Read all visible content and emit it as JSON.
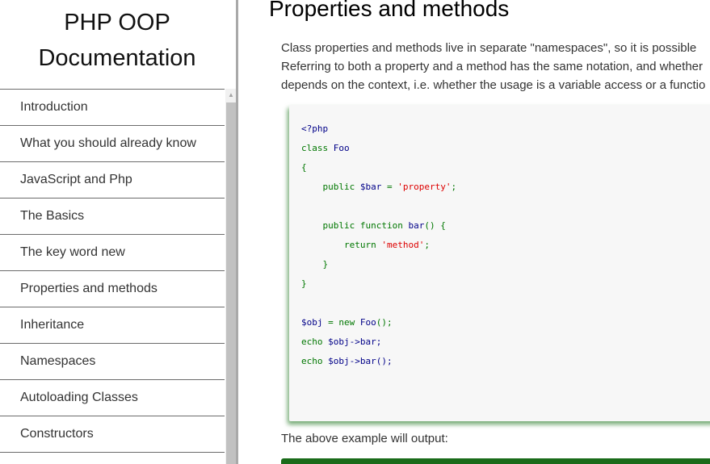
{
  "sidebar": {
    "title_line1": "PHP OOP",
    "title_line2": "Documentation",
    "items": [
      {
        "label": "Introduction"
      },
      {
        "label": "What you should already know"
      },
      {
        "label": "JavaScript and Php"
      },
      {
        "label": "The Basics"
      },
      {
        "label": "The key word new"
      },
      {
        "label": "Properties and methods"
      },
      {
        "label": "Inheritance"
      },
      {
        "label": "Namespaces"
      },
      {
        "label": "Autoloading Classes"
      },
      {
        "label": "Constructors"
      }
    ],
    "scroll_up_icon": "triangle-up-icon"
  },
  "main": {
    "title": "Properties and methods",
    "intro": [
      "Class properties and methods live in separate \"namespaces\", so it is possible",
      "Referring to both a property and a method has the same notation, and whether",
      "depends on the context, i.e. whether the usage is a variable access or a functio"
    ],
    "code": {
      "open_tag": "<?php",
      "class_kw": "class",
      "class_name": "Foo",
      "brace_open": "{",
      "public1": "public",
      "prop_var": "$bar",
      "assign": "=",
      "prop_val": "'property'",
      "semicolon": ";",
      "public2": "public",
      "function_kw": "function",
      "method_name": "bar",
      "method_sig_rest": "() {",
      "return_kw": "return",
      "return_val": "'method'",
      "inner_close": "}",
      "brace_close": "}",
      "obj_var": "$obj",
      "new_kw": "new",
      "new_class": "Foo",
      "new_rest": "();",
      "echo1": "echo",
      "echo1_expr": "$obj->bar;",
      "echo2": "echo",
      "echo2_expr": "$obj->bar();"
    },
    "output_label": "The above example will output:"
  },
  "colors": {
    "code_keyword": "#007700",
    "code_variable": "#000088",
    "code_string": "#dd0000",
    "output_bar": "#1a6b1a"
  }
}
